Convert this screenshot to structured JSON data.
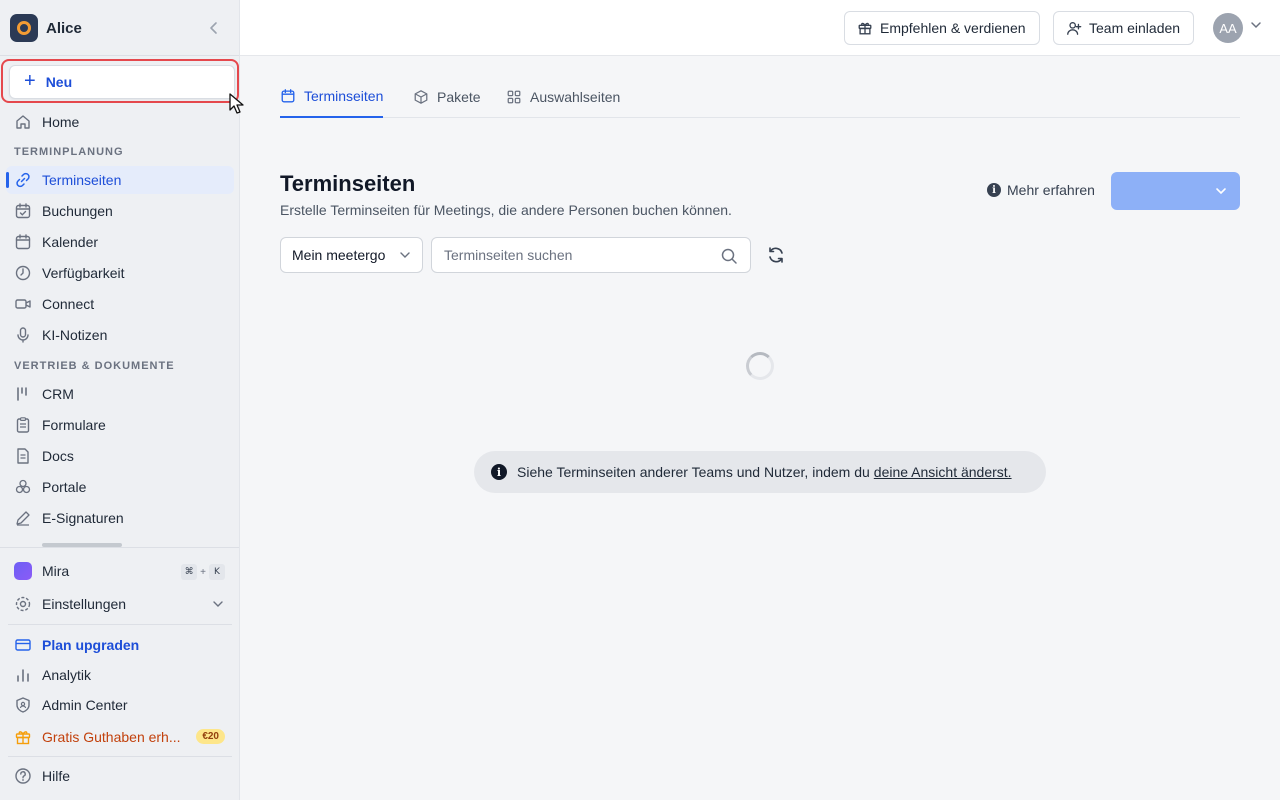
{
  "workspace": {
    "name": "Alice"
  },
  "sidebar": {
    "new_label": "Neu",
    "home": "Home",
    "section_scheduling": "TERMINPLANUNG",
    "scheduling_items": [
      {
        "label": "Terminseiten",
        "icon": "link-icon"
      },
      {
        "label": "Buchungen",
        "icon": "calendar-check-icon"
      },
      {
        "label": "Kalender",
        "icon": "calendar-icon"
      },
      {
        "label": "Verfügbarkeit",
        "icon": "clock-icon"
      },
      {
        "label": "Connect",
        "icon": "video-icon"
      },
      {
        "label": "KI-Notizen",
        "icon": "microphone-icon"
      }
    ],
    "section_sales": "VERTRIEB & DOKUMENTE",
    "sales_items": [
      {
        "label": "CRM",
        "icon": "crm-icon"
      },
      {
        "label": "Formulare",
        "icon": "clipboard-icon"
      },
      {
        "label": "Docs",
        "icon": "document-icon"
      },
      {
        "label": "Portale",
        "icon": "portal-icon"
      },
      {
        "label": "E-Signaturen",
        "icon": "pen-icon"
      }
    ],
    "mira": "Mira",
    "mira_shortcut": [
      "⌘",
      "+",
      "K"
    ],
    "settings": "Einstellungen",
    "upgrade": "Plan upgraden",
    "analytics": "Analytik",
    "admin": "Admin Center",
    "credit": "Gratis Guthaben erh...",
    "credit_badge": "€20",
    "help": "Hilfe"
  },
  "topbar": {
    "refer": "Empfehlen & verdienen",
    "invite": "Team einladen",
    "avatar_initials": "AA"
  },
  "tabs": [
    {
      "label": "Terminseiten",
      "active": true
    },
    {
      "label": "Pakete",
      "active": false
    },
    {
      "label": "Auswahlseiten",
      "active": false
    }
  ],
  "main": {
    "title": "Terminseiten",
    "subtitle": "Erstelle Terminseiten für Meetings, die andere Personen buchen können.",
    "learn_more": "Mehr erfahren",
    "filter_value": "Mein meetergo",
    "search_placeholder": "Terminseiten suchen",
    "notice_text": "Siehe Terminseiten anderer Teams und Nutzer, indem du",
    "notice_link": "deine Ansicht änderst."
  },
  "colors": {
    "accent": "#2563eb",
    "highlight_border": "#e5484d",
    "primary_button": "#8db0f7"
  }
}
